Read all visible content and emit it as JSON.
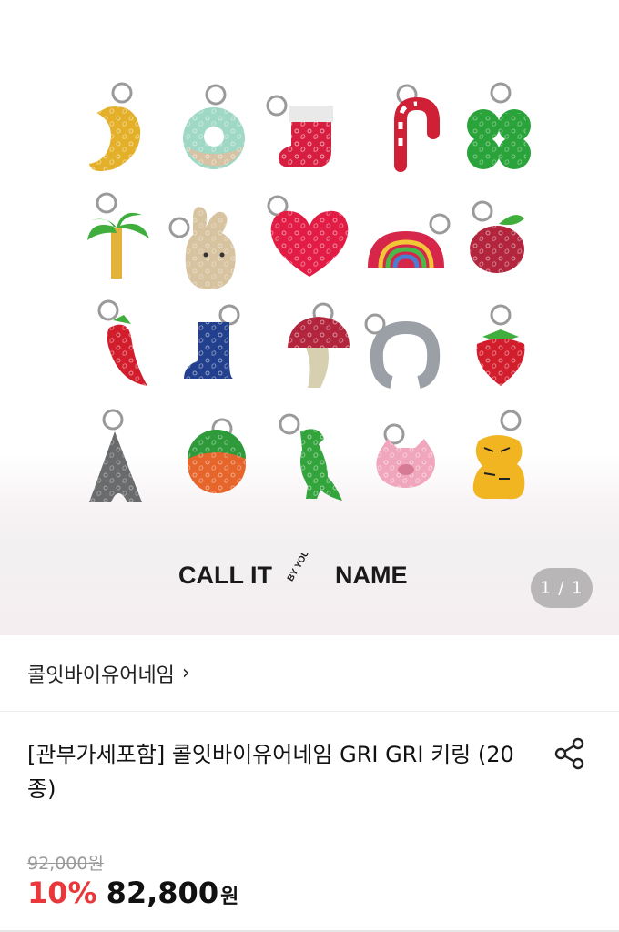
{
  "gallery": {
    "counter": "1 / 1",
    "logo_text_left": "CALL IT",
    "logo_text_mid": "BY YOUR",
    "logo_text_right": "NAME",
    "items": [
      "croissant-keyring",
      "donut-keyring",
      "stocking-keyring",
      "candy-cane-keyring",
      "clover-keyring",
      "palm-tree-keyring",
      "bunny-keyring",
      "heart-keyring",
      "rainbow-keyring",
      "apple-keyring",
      "chili-keyring",
      "boot-keyring",
      "mushroom-keyring",
      "horseshoe-keyring",
      "strawberry-keyring",
      "eiffel-tower-keyring",
      "orange-keyring",
      "dinosaur-keyring",
      "pig-keyring",
      "tiger-keyring"
    ]
  },
  "brand": {
    "name": "콜잇바이유어네임",
    "chevron": "›"
  },
  "product": {
    "title": "[관부가세포함] 콜잇바이유어네임 GRI GRI 키링 (20종)",
    "original_price": "92,000원",
    "discount": "10%",
    "price": "82,800",
    "currency": "원"
  },
  "colors": {
    "discount": "#e8383c",
    "counter_bg": "#b9b6b7"
  }
}
